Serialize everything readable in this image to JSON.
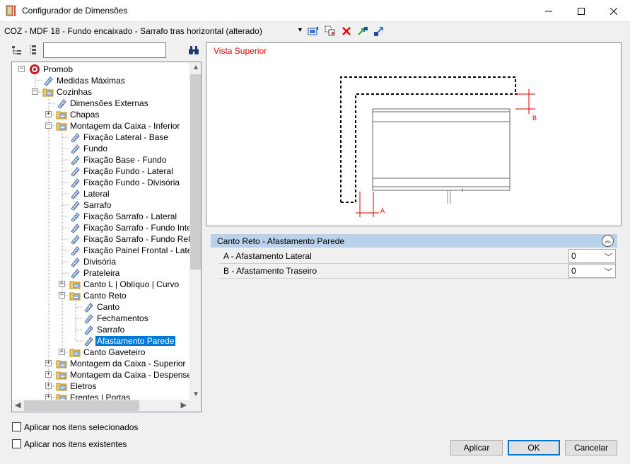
{
  "window": {
    "title": "Configurador de Dimensões"
  },
  "toolbar": {
    "combo_value": "COZ - MDF 18 - Fundo encaixado - Sarrafo tras horizontal (alterado)"
  },
  "search": {
    "value": "",
    "placeholder": ""
  },
  "tree": {
    "items": [
      {
        "label": "Promob"
      },
      {
        "label": "Medidas Máximas"
      },
      {
        "label": "Cozinhas"
      },
      {
        "label": "Dimensões Externas"
      },
      {
        "label": "Chapas"
      },
      {
        "label": "Montagem da Caixa - Inferior"
      },
      {
        "label": "Fixação Lateral - Base"
      },
      {
        "label": "Fundo"
      },
      {
        "label": "Fixação Base - Fundo"
      },
      {
        "label": "Fixação Fundo - Lateral"
      },
      {
        "label": "Fixação Fundo - Divisória"
      },
      {
        "label": "Lateral"
      },
      {
        "label": "Sarrafo"
      },
      {
        "label": "Fixação Sarrafo - Lateral"
      },
      {
        "label": "Fixação Sarrafo - Fundo Inteiro"
      },
      {
        "label": "Fixação Sarrafo - Fundo Rebaix"
      },
      {
        "label": "Fixação Painel Frontal - Lateral"
      },
      {
        "label": "Divisória"
      },
      {
        "label": "Prateleira"
      },
      {
        "label": "Canto L | Oblíquo | Curvo"
      },
      {
        "label": "Canto Reto"
      },
      {
        "label": "Canto"
      },
      {
        "label": "Fechamentos"
      },
      {
        "label": "Sarrafo"
      },
      {
        "label": "Afastamento Parede"
      },
      {
        "label": "Canto Gaveteiro"
      },
      {
        "label": "Montagem da Caixa - Superior"
      },
      {
        "label": "Montagem da Caixa - Despenseiros"
      },
      {
        "label": "Eletros"
      },
      {
        "label": "Frentes | Portas"
      }
    ]
  },
  "preview": {
    "title": "Vista Superior",
    "dim_a": "A",
    "dim_b": "B"
  },
  "properties": {
    "group_title": "Canto Reto - Afastamento Parede",
    "rows": [
      {
        "label": "A - Afastamento Lateral",
        "value": "0"
      },
      {
        "label": "B - Afastamento Traseiro",
        "value": "0"
      }
    ]
  },
  "options": {
    "apply_selected": "Aplicar nos itens selecionados",
    "apply_existing": "Aplicar nos itens existentes"
  },
  "buttons": {
    "apply": "Aplicar",
    "ok": "OK",
    "cancel": "Cancelar"
  },
  "colors": {
    "selection": "#0078d7",
    "header": "#b9d1ea",
    "preview_title": "#e00000"
  }
}
